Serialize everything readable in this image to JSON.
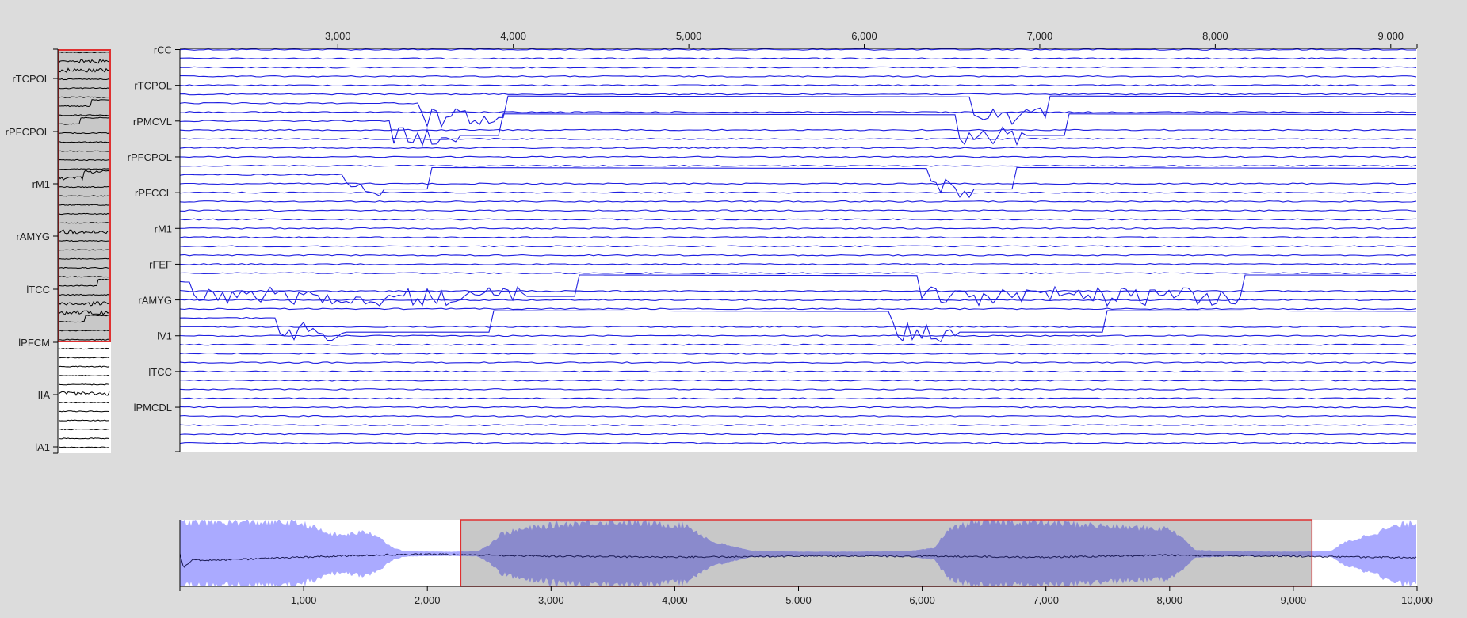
{
  "colors": {
    "background": "#dcdcdc",
    "panel": "#ffffff",
    "trace": "#1f1fe0",
    "overview_trace": "#000000",
    "selection_border": "#e03030",
    "selection_fill": "#c8c8c8",
    "context_fill": "#aaaaff",
    "context_fill_selected": "#8a8acc"
  },
  "chart_data": [
    {
      "name": "focus",
      "type": "line",
      "series_count": 45,
      "x_range": [
        2100,
        9150
      ],
      "x_ticks": [
        "3,000",
        "4,000",
        "5,000",
        "6,000",
        "7,000",
        "8,000",
        "9,000"
      ],
      "x_tick_values": [
        3000,
        4000,
        5000,
        6000,
        7000,
        8000,
        9000
      ],
      "y_labels": [
        "rCC",
        "rTCPOL",
        "rPMCVL",
        "rPFCPOL",
        "rPFCCL",
        "rM1",
        "rFEF",
        "rAMYG",
        "lV1",
        "lTCC",
        "lPMCDL"
      ],
      "y_label_rows": [
        0,
        4,
        8,
        12,
        16,
        20,
        24,
        28,
        32,
        36,
        40
      ],
      "events": [
        {
          "row": 6,
          "times": [
            3480,
            3950,
            6600,
            7050
          ],
          "burst": 420
        },
        {
          "row": 8,
          "times": [
            3300,
            3920,
            6520,
            7150
          ],
          "burst": 380
        },
        {
          "row": 14,
          "times": [
            3040,
            3510,
            6380,
            6850
          ],
          "burst": 220
        },
        {
          "row": 26,
          "times": [
            2170,
            4360,
            6320,
            8150
          ],
          "burst": 1900
        },
        {
          "row": 30,
          "times": [
            2650,
            3870,
            6160,
            7380
          ],
          "burst": 380
        }
      ]
    },
    {
      "name": "overview",
      "type": "line",
      "y_labels": [
        "rTCPOL",
        "rPFCPOL",
        "rM1",
        "rAMYG",
        "lTCC",
        "lPFCM",
        "lIA",
        "lA1"
      ]
    },
    {
      "name": "context",
      "type": "area",
      "x_range": [
        0,
        10000
      ],
      "x_ticks": [
        "1,000",
        "2,000",
        "3,000",
        "4,000",
        "5,000",
        "6,000",
        "7,000",
        "8,000",
        "9,000",
        "10,000"
      ],
      "x_tick_values": [
        1000,
        2000,
        3000,
        4000,
        5000,
        6000,
        7000,
        8000,
        9000,
        10000
      ],
      "selection": [
        2270,
        9150
      ],
      "envelope": [
        [
          0,
          0.95
        ],
        [
          100,
          0.95
        ],
        [
          300,
          0.95
        ],
        [
          600,
          0.95
        ],
        [
          900,
          0.95
        ],
        [
          1000,
          0.9
        ],
        [
          1100,
          0.75
        ],
        [
          1200,
          0.6
        ],
        [
          1300,
          0.55
        ],
        [
          1400,
          0.6
        ],
        [
          1500,
          0.65
        ],
        [
          1600,
          0.55
        ],
        [
          1700,
          0.2
        ],
        [
          1800,
          0.07
        ],
        [
          1900,
          0.05
        ],
        [
          2200,
          0.04
        ],
        [
          2400,
          0.05
        ],
        [
          2500,
          0.25
        ],
        [
          2600,
          0.6
        ],
        [
          2800,
          0.75
        ],
        [
          3000,
          0.85
        ],
        [
          3300,
          0.95
        ],
        [
          3600,
          0.95
        ],
        [
          3800,
          0.9
        ],
        [
          4100,
          0.85
        ],
        [
          4300,
          0.35
        ],
        [
          4600,
          0.08
        ],
        [
          5000,
          0.04
        ],
        [
          5500,
          0.04
        ],
        [
          5900,
          0.06
        ],
        [
          6100,
          0.15
        ],
        [
          6200,
          0.7
        ],
        [
          6400,
          0.95
        ],
        [
          6800,
          0.95
        ],
        [
          7200,
          0.9
        ],
        [
          7600,
          0.8
        ],
        [
          8000,
          0.75
        ],
        [
          8100,
          0.5
        ],
        [
          8200,
          0.1
        ],
        [
          8500,
          0.05
        ],
        [
          9000,
          0.04
        ],
        [
          9300,
          0.06
        ],
        [
          9400,
          0.3
        ],
        [
          9600,
          0.55
        ],
        [
          9800,
          0.8
        ],
        [
          10000,
          0.95
        ]
      ],
      "mean_line": [
        [
          0,
          0.1
        ],
        [
          30,
          -0.6
        ],
        [
          100,
          -0.2
        ],
        [
          400,
          -0.18
        ],
        [
          1000,
          -0.05
        ],
        [
          1500,
          0.05
        ],
        [
          2000,
          0.1
        ],
        [
          3000,
          0.0
        ],
        [
          4000,
          -0.05
        ],
        [
          5000,
          0.0
        ],
        [
          6000,
          0.0
        ],
        [
          7000,
          -0.05
        ],
        [
          8000,
          0.05
        ],
        [
          9000,
          0.0
        ],
        [
          10000,
          -0.08
        ]
      ]
    }
  ]
}
